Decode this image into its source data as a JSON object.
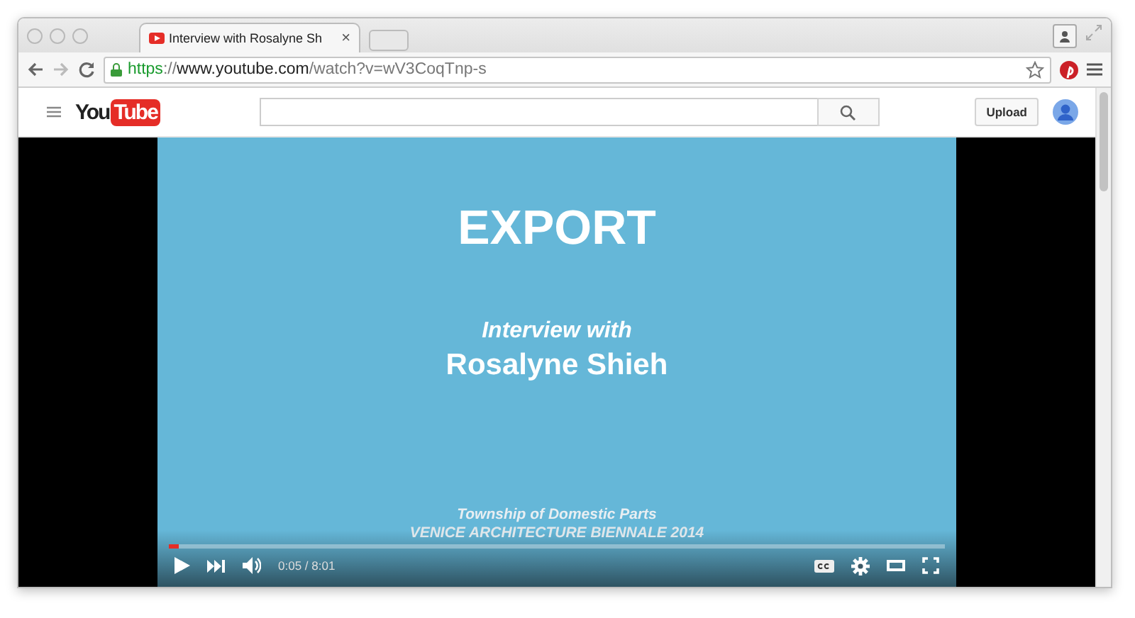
{
  "browser": {
    "tab": {
      "title": "Interview with Rosalyne Sh",
      "close": "×",
      "selected": true
    },
    "address": [
      {
        "text": "https",
        "kind": "scheme"
      },
      {
        "text": "://",
        "kind": "separator"
      },
      {
        "text": "www.youtube.com",
        "kind": "host"
      },
      {
        "text": "/watch?v=wV3CoqTnp-s",
        "kind": "path"
      }
    ]
  },
  "site": {
    "logo": [
      "You",
      "Tube"
    ],
    "upload": "Upload"
  },
  "video": {
    "slide": [
      {
        "text": "EXPORT",
        "kind": "headline"
      },
      {
        "text": "Interview with",
        "kind": "subtitle"
      },
      {
        "text": "Rosalyne Shieh",
        "kind": "name"
      }
    ],
    "captions": [
      "Township of Domestic Parts",
      "VENICE ARCHITECTURE BIENNALE 2014"
    ],
    "progress": {
      "level": 0.012
    },
    "time": "0:05 / 8:01"
  }
}
